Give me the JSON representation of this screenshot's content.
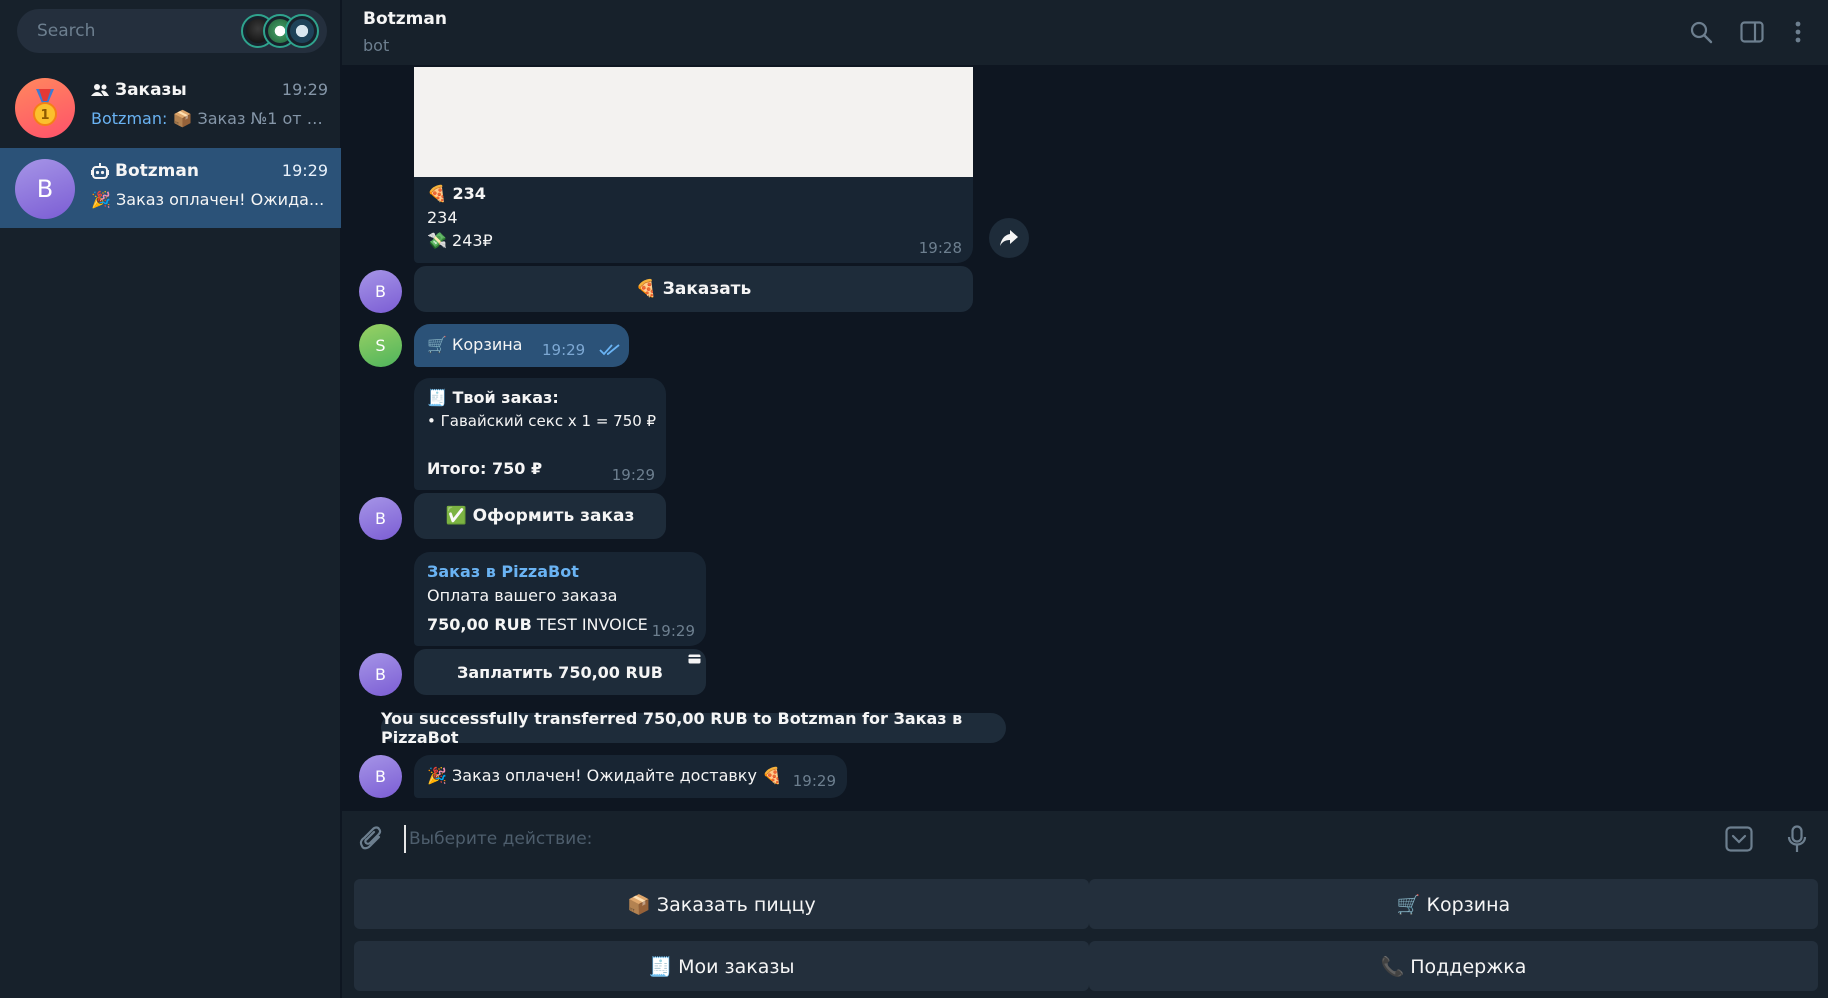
{
  "sidebar": {
    "search": {
      "placeholder": "Search"
    },
    "chats": [
      {
        "title": "Заказы",
        "time": "19:29",
        "sender": "Botzman:",
        "preview": " 📦 Заказ №1 от 0...",
        "avatar_icon": "medal-icon"
      },
      {
        "title": "Botzman",
        "time": "19:29",
        "preview": "🎉 Заказ оплачен! Ожида...",
        "avatar_letter": "B"
      }
    ]
  },
  "header": {
    "name": "Botzman",
    "status": "bot"
  },
  "messages": {
    "product": {
      "title": "🍕 234",
      "desc": "234",
      "price": "💸 243₽",
      "time": "19:28"
    },
    "order_btn": "🍕 Заказать",
    "cart_msg": {
      "text": "🛒 Корзина",
      "time": "19:29",
      "avatar_letter": "S"
    },
    "order_summary": {
      "title": "🧾 Твой заказ:",
      "item": "• Гавайский секс x 1 = 750 ₽",
      "total": "Итого: 750 ₽",
      "time": "19:29"
    },
    "checkout_btn": "✅ Оформить заказ",
    "invoice": {
      "title": "Заказ в PizzaBot",
      "desc": "Оплата вашего заказа",
      "amount": "750,00 RUB",
      "label": "TEST INVOICE",
      "time": "19:29"
    },
    "pay_btn": "Заплатить 750,00 RUB",
    "service": "You successfully transferred 750,00 RUB to Botzman for Заказ в PizzaBot",
    "paid_msg": {
      "text": "🎉 Заказ оплачен! Ожидайте доставку 🍕",
      "time": "19:29"
    },
    "bot_avatar_letter": "B"
  },
  "composer": {
    "placeholder": "Выберите действие:"
  },
  "keyboard": {
    "buttons": [
      "📦 Заказать пиццу",
      "🛒 Корзина",
      "🧾 Мои заказы",
      "📞 Поддержка"
    ]
  }
}
